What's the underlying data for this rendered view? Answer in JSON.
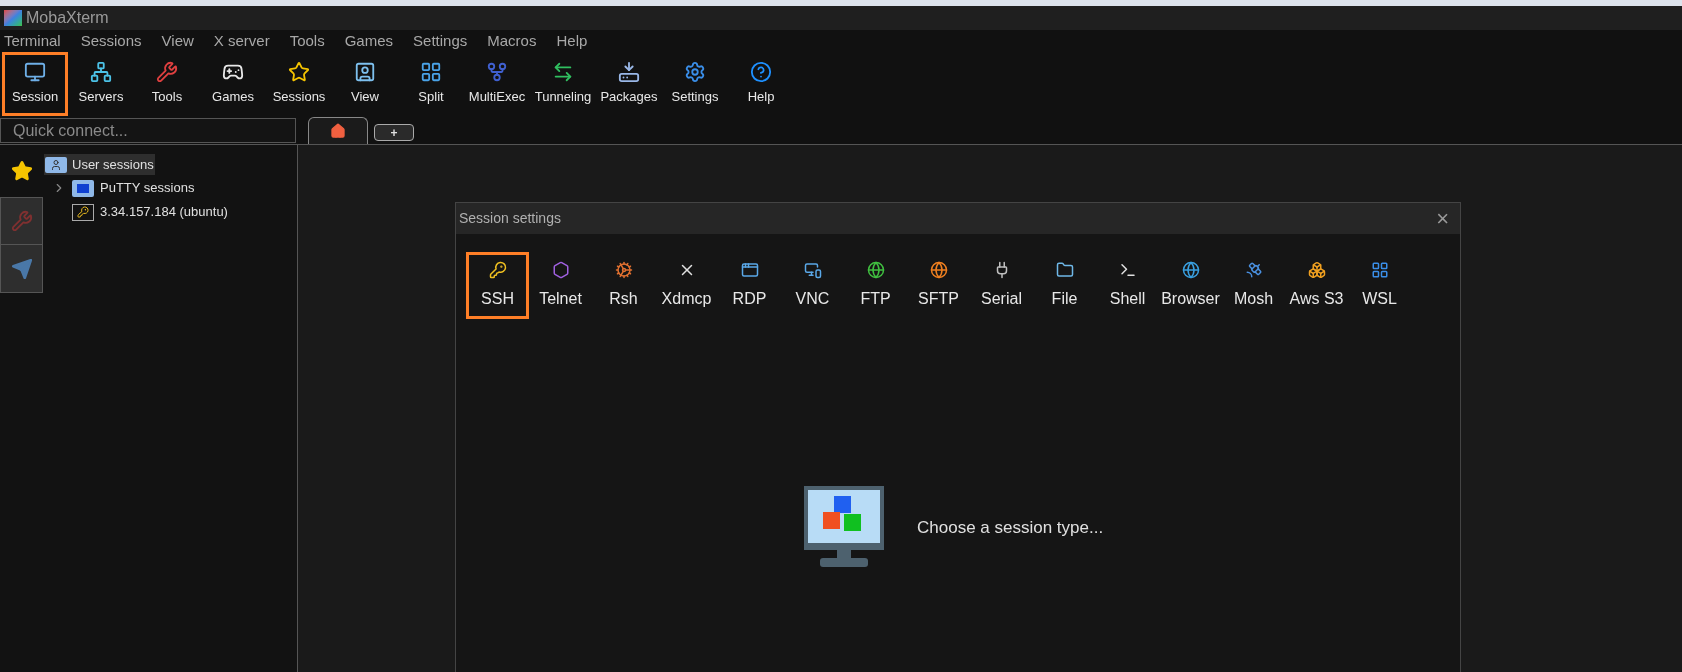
{
  "window": {
    "title": "MobaXterm"
  },
  "menu": [
    "Terminal",
    "Sessions",
    "View",
    "X server",
    "Tools",
    "Games",
    "Settings",
    "Macros",
    "Help"
  ],
  "toolbar": [
    {
      "label": "Session",
      "highlighted": true
    },
    {
      "label": "Servers",
      "highlighted": false
    },
    {
      "label": "Tools",
      "highlighted": false
    },
    {
      "label": "Games",
      "highlighted": false
    },
    {
      "label": "Sessions",
      "highlighted": false
    },
    {
      "label": "View",
      "highlighted": false
    },
    {
      "label": "Split",
      "highlighted": false
    },
    {
      "label": "MultiExec",
      "highlighted": false
    },
    {
      "label": "Tunneling",
      "highlighted": false
    },
    {
      "label": "Packages",
      "highlighted": false
    },
    {
      "label": "Settings",
      "highlighted": false
    },
    {
      "label": "Help",
      "highlighted": false
    }
  ],
  "quick_connect": {
    "placeholder": "Quick connect..."
  },
  "tabs": [
    {
      "kind": "home",
      "selected": true
    },
    {
      "kind": "new",
      "label": "+",
      "selected": false
    }
  ],
  "sidebar": {
    "tree": [
      {
        "label": "User sessions",
        "selected": true,
        "children": [
          {
            "label": "PuTTY sessions",
            "expanded": false,
            "kind": "folder"
          },
          {
            "label": "3.34.157.184 (ubuntu)",
            "kind": "session"
          }
        ]
      }
    ]
  },
  "dialog": {
    "title": "Session settings",
    "close": "×",
    "session_types": [
      {
        "label": "SSH",
        "highlighted": true
      },
      {
        "label": "Telnet",
        "highlighted": false
      },
      {
        "label": "Rsh",
        "highlighted": false
      },
      {
        "label": "Xdmcp",
        "highlighted": false
      },
      {
        "label": "RDP",
        "highlighted": false
      },
      {
        "label": "VNC",
        "highlighted": false
      },
      {
        "label": "FTP",
        "highlighted": false
      },
      {
        "label": "SFTP",
        "highlighted": false
      },
      {
        "label": "Serial",
        "highlighted": false
      },
      {
        "label": "File",
        "highlighted": false
      },
      {
        "label": "Shell",
        "highlighted": false
      },
      {
        "label": "Browser",
        "highlighted": false
      },
      {
        "label": "Mosh",
        "highlighted": false
      },
      {
        "label": "Aws S3",
        "highlighted": false
      },
      {
        "label": "WSL",
        "highlighted": false
      }
    ],
    "prompt": "Choose a session type..."
  }
}
